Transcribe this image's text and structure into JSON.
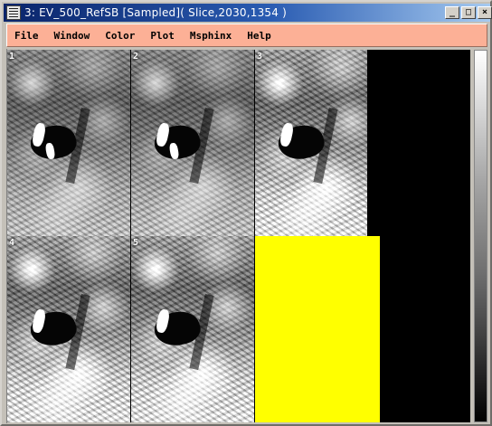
{
  "window": {
    "title": "3: EV_500_RefSB [Sampled]( Slice,2030,1354 )",
    "icon": "window-menu-icon"
  },
  "menu": [
    "File",
    "Window",
    "Color",
    "Plot",
    "Msphinx",
    "Help"
  ],
  "controls": {
    "minimize": "_",
    "maximize": "□",
    "close": "×"
  },
  "panels": [
    {
      "label": "1"
    },
    {
      "label": "2"
    },
    {
      "label": "3"
    },
    {
      "label": "4"
    },
    {
      "label": "5"
    }
  ],
  "colors": {
    "menu_bg": "#fcb096",
    "yellow_panel": "#ffff00",
    "titlebar_start": "#0a246a",
    "titlebar_end": "#a6caf0"
  }
}
